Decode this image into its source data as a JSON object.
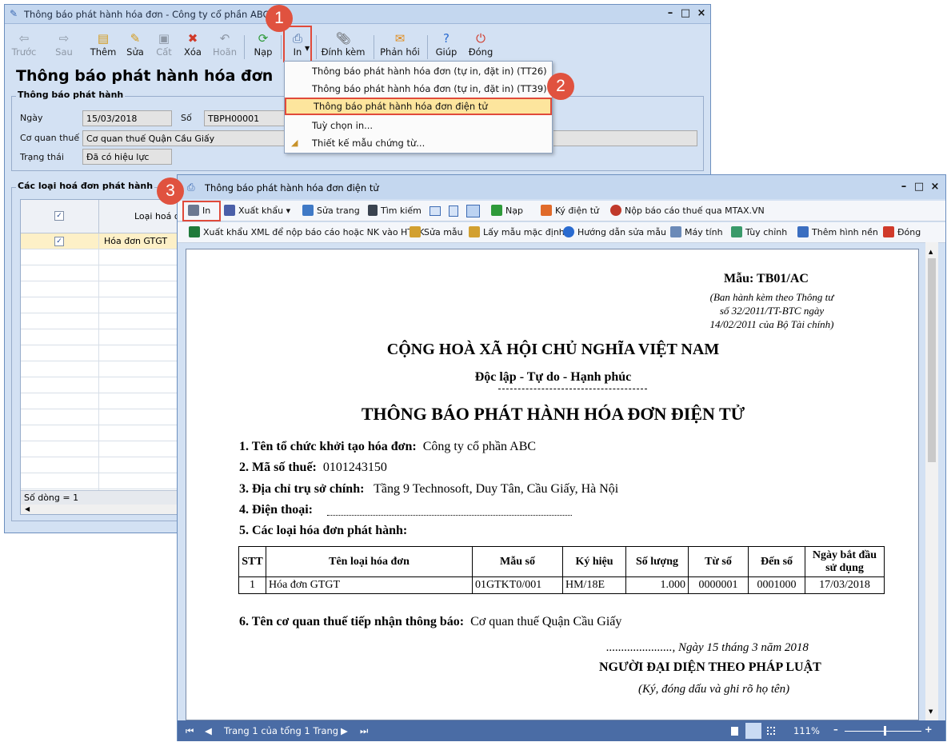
{
  "back_window": {
    "title": "Thông báo phát hành hóa đơn - Công ty cổ phần ABC",
    "toolbar": {
      "prev": "Trước",
      "next": "Sau",
      "add": "Thêm",
      "edit": "Sửa",
      "save": "Cất",
      "delete": "Xóa",
      "undo": "Hoãn",
      "reload": "Nạp",
      "print": "In",
      "attach": "Đính kèm",
      "feedback": "Phản hồi",
      "help": "Giúp",
      "close": "Đóng"
    },
    "heading": "Thông báo phát hành hóa đơn",
    "group_title": "Thông báo phát hành",
    "date_label": "Ngày",
    "date_value": "15/03/2018",
    "number_label": "Số",
    "number_value": "TBPH00001",
    "tax_office_label": "Cơ quan thuế",
    "tax_office_value": "Cơ quan thuế Quận Cầu Giấy",
    "status_label": "Trạng thái",
    "status_value": "Đã có hiệu lực",
    "types_group_title": "Các loại hoá đơn phát hành",
    "grid": {
      "col_type": "Loại hoá đơ",
      "row1_type": "Hóa đơn GTGT",
      "row_count": "Số dòng = 1"
    }
  },
  "print_menu": {
    "items": [
      "Thông báo phát hành hóa đơn (tự in, đặt in) (TT26)",
      "Thông báo phát hành hóa đơn (tự in, đặt in) (TT39)",
      "Thông báo phát hành hóa đơn điện tử",
      "Tuỳ chọn in...",
      "Thiết kế mẫu chứng từ..."
    ]
  },
  "badges": [
    "1",
    "2",
    "3"
  ],
  "front_window": {
    "title": "Thông báo phát hành hóa đơn điện tử",
    "toolbar1": {
      "print": "In",
      "export": "Xuất khẩu",
      "edit_page": "Sửa trang",
      "search": "Tìm kiếm",
      "reload": "Nạp",
      "esign": "Ký điện tử",
      "submit_mtax": "Nộp báo cáo thuế qua MTAX.VN"
    },
    "toolbar2": {
      "export_xml": "Xuất khẩu XML để nộp báo cáo hoặc NK vào HTKK",
      "edit_template": "Sửa mẫu",
      "default_template": "Lấy mẫu mặc định",
      "guide": "Hướng dẫn sửa mẫu",
      "calculator": "Máy tính",
      "options": "Tùy chỉnh",
      "background": "Thêm hình nền",
      "close": "Đóng"
    },
    "status": {
      "page": "Trang 1 của tổng 1 Trang",
      "zoom": "111%"
    }
  },
  "document": {
    "form_code": "Mẫu: TB01/AC",
    "legal_note_1": "(Ban hành kèm theo Thông tư",
    "legal_note_2": "số 32/2011/TT-BTC ngày",
    "legal_note_3": "14/02/2011 của Bộ Tài chính)",
    "nation": "CỘNG HOÀ XÃ HỘI CHỦ NGHĨA VIỆT NAM",
    "motto": "Độc lập - Tự do - Hạnh phúc",
    "title": "THÔNG BÁO PHÁT HÀNH HÓA ĐƠN ĐIỆN TỬ",
    "l1_label": "1. Tên tổ chức khởi tạo hóa đơn:",
    "l1_value": "Công ty cổ phần ABC",
    "l2_label": "2. Mã số thuế:",
    "l2_value": "0101243150",
    "l3_label": "3. Địa chỉ trụ sở chính:",
    "l3_value": "Tầng 9 Technosoft, Duy Tân, Cầu Giấy, Hà Nội",
    "l4_label": "4. Điện thoại:",
    "l5_label": "5. Các loại hóa đơn phát hành:",
    "table_headers": [
      "STT",
      "Tên loại hóa đơn",
      "Mẫu số",
      "Ký hiệu",
      "Số lượng",
      "Từ số",
      "Đến số",
      "Ngày bắt đầu sử dụng"
    ],
    "table_row": [
      "1",
      "Hóa đơn GTGT",
      "01GTKT0/001",
      "HM/18E",
      "1.000",
      "0000001",
      "0001000",
      "17/03/2018"
    ],
    "l6_label": "6. Tên cơ quan thuế tiếp nhận thông báo:",
    "l6_value": "Cơ quan thuế Quận Cầu Giấy",
    "date_line": "......................, Ngày 15 tháng 3 năm 2018",
    "signer": "NGƯỜI ĐẠI DIỆN THEO PHÁP LUẬT",
    "signer_note": "(Ký, đóng dấu và ghi rõ họ tên)"
  }
}
